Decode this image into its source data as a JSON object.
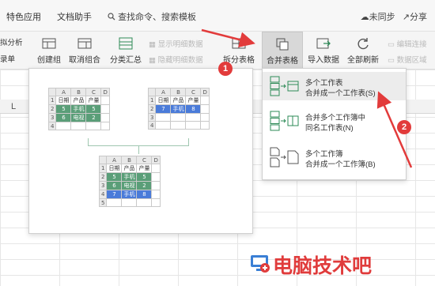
{
  "topbar": {
    "tabs": [
      "特色应用",
      "文档助手"
    ],
    "search": "查找命令、搜索模板",
    "sync": "未同步",
    "share": "分享"
  },
  "ribbon": {
    "cut_left_top": "拟分析",
    "cut_left_bottom": "录单",
    "buttons": [
      {
        "label": "创建组"
      },
      {
        "label": "取消组合"
      },
      {
        "label": "分类汇总"
      },
      {
        "label": "拆分表格"
      },
      {
        "label": "合并表格"
      },
      {
        "label": "导入数据"
      },
      {
        "label": "全部刷新"
      }
    ],
    "disabled": {
      "show_detail": "显示明细数据",
      "hide_detail": "隐藏明细数据",
      "edit_link": "编辑连接",
      "data_region": "数据区域"
    }
  },
  "sheet": {
    "column_letter": "L"
  },
  "preview": {
    "col_letters": [
      "A",
      "B",
      "C",
      "D"
    ],
    "table1": {
      "rows": [
        [
          "1",
          "日期",
          "产品",
          "产量",
          ""
        ],
        [
          "2",
          "5",
          "手机",
          "5",
          ""
        ],
        [
          "3",
          "6",
          "电视",
          "2",
          ""
        ],
        [
          "4",
          "",
          "",
          "",
          ""
        ]
      ]
    },
    "table2": {
      "rows": [
        [
          "1",
          "日期",
          "产品",
          "产量",
          ""
        ],
        [
          "2",
          "7",
          "手机",
          "8",
          ""
        ],
        [
          "3",
          "",
          "",
          "",
          ""
        ],
        [
          "4",
          "",
          "",
          "",
          ""
        ]
      ]
    },
    "table3": {
      "rows": [
        [
          "1",
          "日期",
          "产品",
          "产量",
          ""
        ],
        [
          "2",
          "5",
          "手机",
          "5",
          ""
        ],
        [
          "3",
          "6",
          "电视",
          "2",
          ""
        ],
        [
          "4",
          "7",
          "手机",
          "8",
          ""
        ],
        [
          "5",
          "",
          "",
          "",
          ""
        ]
      ]
    }
  },
  "menu": {
    "items": [
      {
        "line1": "多个工作表",
        "line2": "合并成一个工作表(S)"
      },
      {
        "line1": "合并多个工作簿中",
        "line2": "同名工作表(N)"
      },
      {
        "line1": "多个工作簿",
        "line2": "合并成一个工作簿(B)"
      }
    ]
  },
  "annotations": {
    "badge1": "1",
    "badge2": "2",
    "accent": "#e23b3b"
  },
  "watermark": {
    "text": "电脑技术吧"
  }
}
